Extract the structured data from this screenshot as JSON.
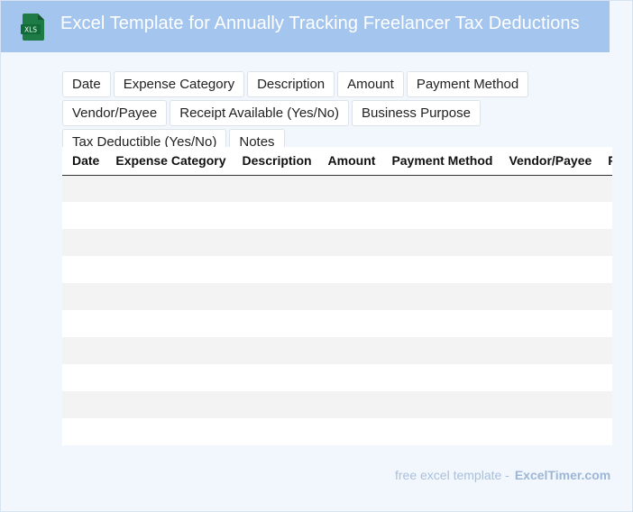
{
  "header": {
    "title": "Excel Template for Annually Tracking Freelancer Tax Deductions",
    "icon_text": "XLS",
    "icon_color": "#1e7b45",
    "background": "#a3c5ee"
  },
  "chips": [
    "Date",
    "Expense Category",
    "Description",
    "Amount",
    "Payment Method",
    "Vendor/Payee",
    "Receipt Available (Yes/No)",
    "Business Purpose",
    "Tax Deductible (Yes/No)",
    "Notes"
  ],
  "table": {
    "columns": [
      "Date",
      "Expense Category",
      "Description",
      "Amount",
      "Payment Method",
      "Vendor/Payee",
      "Receipt Available (Yes/No)"
    ],
    "row_count": 10
  },
  "footer": {
    "text": "free excel template -",
    "brand": "ExcelTimer.com"
  }
}
